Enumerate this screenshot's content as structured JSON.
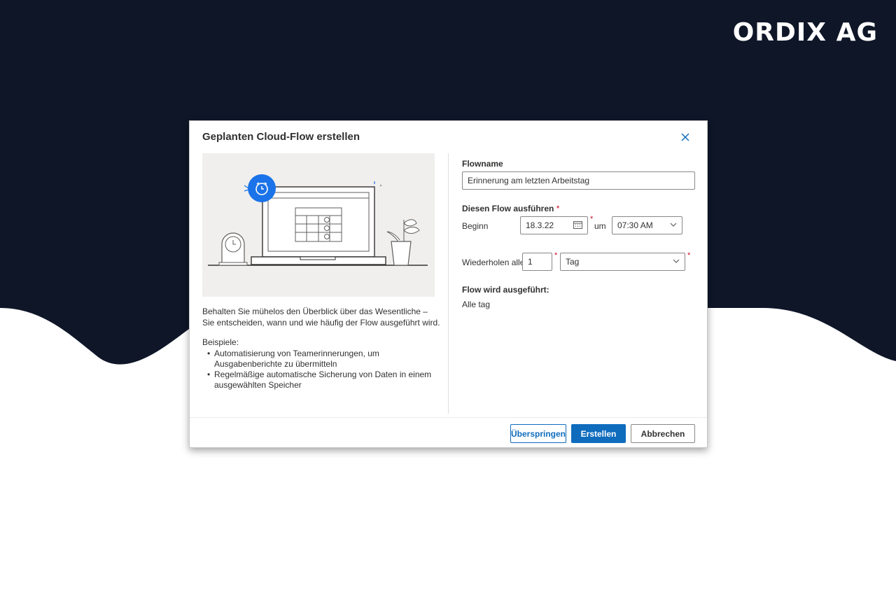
{
  "brand": {
    "logo_text": "ORDIX AG"
  },
  "dialog": {
    "title": "Geplanten Cloud-Flow erstellen",
    "close_icon": "close-icon",
    "left": {
      "description": "Behalten Sie mühelos den Überblick über das Wesentliche – Sie entscheiden, wann und wie häufig der Flow ausgeführt wird.",
      "examples_title": "Beispiele:",
      "examples": [
        "Automatisierung von Teamerinnerungen, um Ausgabenberichte zu übermitteln",
        "Regelmäßige automatische Sicherung von Daten in einem ausgewählten Speicher"
      ]
    },
    "form": {
      "flowname_label": "Flowname",
      "flowname_value": "Erinnerung am letzten Arbeitstag",
      "run_label": "Diesen Flow ausführen",
      "required_mark": "*",
      "start_label": "Beginn",
      "start_date": "18.3.22",
      "at_label": "um",
      "start_time": "07:30 AM",
      "repeat_label": "Wiederholen alle",
      "repeat_interval": "1",
      "repeat_unit": "Tag",
      "runs_label": "Flow wird ausgeführt:",
      "runs_value": "Alle tag"
    },
    "buttons": {
      "skip": "Überspringen",
      "create": "Erstellen",
      "cancel": "Abbrechen"
    }
  },
  "colors": {
    "background_dark": "#0e1628",
    "accent": "#0f6cbd",
    "required": "#c50f1f"
  }
}
